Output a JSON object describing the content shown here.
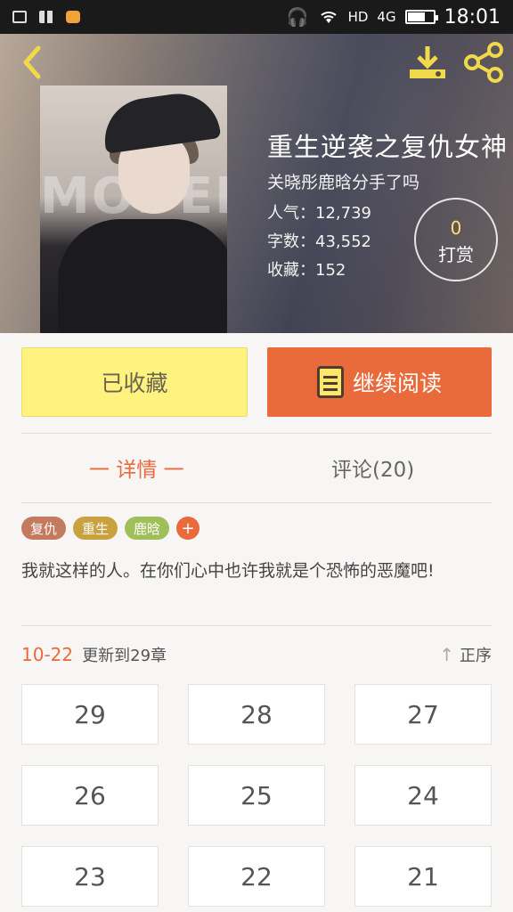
{
  "statusbar": {
    "network_label": "HD",
    "signal_label": "4G",
    "battery_level": 0.7,
    "time": "18:01"
  },
  "book": {
    "title": "重生逆袭之复仇女神",
    "author": "关晓彤鹿晗分手了吗",
    "popularity": "人气：12,739",
    "word_count": "字数：43,552",
    "favorites": "收藏：152",
    "cover_text": "MODERA"
  },
  "tip": {
    "count": "0",
    "label": "打赏"
  },
  "actions": {
    "favorited_label": "已收藏",
    "continue_label": "继续阅读"
  },
  "tabs": [
    {
      "label": "一 详情 一",
      "active": true
    },
    {
      "label": "评论(20)",
      "active": false
    }
  ],
  "tags": [
    {
      "label": "复仇",
      "color": "#c47a5e"
    },
    {
      "label": "重生",
      "color": "#c9a23f"
    },
    {
      "label": "鹿晗",
      "color": "#9fbf58"
    },
    {
      "label": "+",
      "color": "#e96a3b"
    }
  ],
  "description": "我就这样的人。在你们心中也许我就是个恐怖的恶魔吧!",
  "update": {
    "date": "10-22",
    "text": "更新到29章",
    "sort_label": "正序"
  },
  "chapters": [
    "29",
    "28",
    "27",
    "26",
    "25",
    "24",
    "23",
    "22",
    "21"
  ],
  "colors": {
    "accent": "#e96a3b",
    "fav_button": "#fff27f"
  }
}
